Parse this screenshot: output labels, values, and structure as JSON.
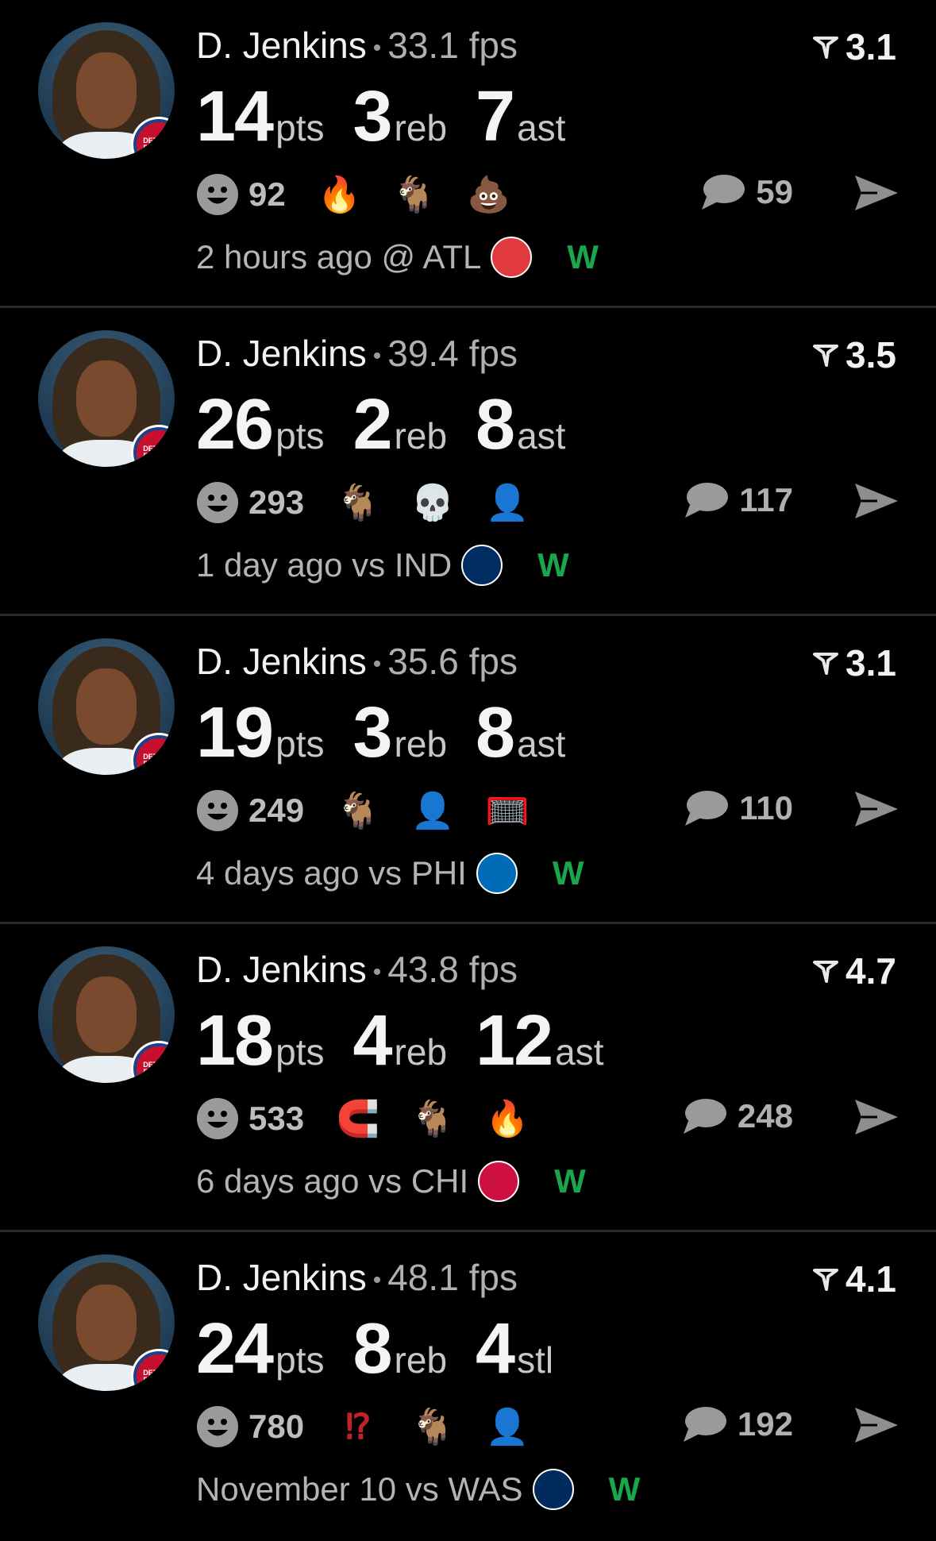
{
  "colors": {
    "win": "#1aa64c",
    "text": "#f2f2f2",
    "muted": "#b0b0b0"
  },
  "posts": [
    {
      "player": "D. Jenkins",
      "fps": "33.1 fps",
      "rating": "3.1",
      "stats": [
        {
          "value": "14",
          "unit": "pts"
        },
        {
          "value": "3",
          "unit": "reb"
        },
        {
          "value": "7",
          "unit": "ast"
        }
      ],
      "reaction_count": "92",
      "emojis": [
        {
          "icon": "fire-icon",
          "glyph": "🔥"
        },
        {
          "icon": "goat-icon",
          "glyph": "🐐"
        },
        {
          "icon": "poop-icon",
          "glyph": "💩"
        }
      ],
      "comment_count": "59",
      "when": "2 hours ago @ ATL",
      "opponent_logo": "hawks-logo",
      "opponent_color": "#e03a3e",
      "result": "W"
    },
    {
      "player": "D. Jenkins",
      "fps": "39.4 fps",
      "rating": "3.5",
      "stats": [
        {
          "value": "26",
          "unit": "pts"
        },
        {
          "value": "2",
          "unit": "reb"
        },
        {
          "value": "8",
          "unit": "ast"
        }
      ],
      "reaction_count": "293",
      "emojis": [
        {
          "icon": "goat-icon",
          "glyph": "🐐"
        },
        {
          "icon": "skull-icon",
          "glyph": "💀"
        },
        {
          "icon": "player-face-icon",
          "glyph": "👤"
        }
      ],
      "comment_count": "117",
      "when": "1 day ago vs IND",
      "opponent_logo": "pacers-logo",
      "opponent_color": "#002d62",
      "result": "W"
    },
    {
      "player": "D. Jenkins",
      "fps": "35.6 fps",
      "rating": "3.1",
      "stats": [
        {
          "value": "19",
          "unit": "pts"
        },
        {
          "value": "3",
          "unit": "reb"
        },
        {
          "value": "8",
          "unit": "ast"
        }
      ],
      "reaction_count": "249",
      "emojis": [
        {
          "icon": "goat-icon",
          "glyph": "🐐"
        },
        {
          "icon": "player-face-icon",
          "glyph": "👤"
        },
        {
          "icon": "basketball-net-icon",
          "glyph": "🥅"
        }
      ],
      "comment_count": "110",
      "when": "4 days ago vs PHI",
      "opponent_logo": "76ers-logo",
      "opponent_color": "#006bb6",
      "result": "W"
    },
    {
      "player": "D. Jenkins",
      "fps": "43.8 fps",
      "rating": "4.7",
      "stats": [
        {
          "value": "18",
          "unit": "pts"
        },
        {
          "value": "4",
          "unit": "reb"
        },
        {
          "value": "12",
          "unit": "ast"
        }
      ],
      "reaction_count": "533",
      "emojis": [
        {
          "icon": "magnet-icon",
          "glyph": "🧲"
        },
        {
          "icon": "goat-icon",
          "glyph": "🐐"
        },
        {
          "icon": "fire-icon",
          "glyph": "🔥"
        }
      ],
      "comment_count": "248",
      "when": "6 days ago vs CHI",
      "opponent_logo": "bulls-logo",
      "opponent_color": "#ce1141",
      "result": "W"
    },
    {
      "player": "D. Jenkins",
      "fps": "48.1 fps",
      "rating": "4.1",
      "stats": [
        {
          "value": "24",
          "unit": "pts"
        },
        {
          "value": "8",
          "unit": "reb"
        },
        {
          "value": "4",
          "unit": "stl"
        }
      ],
      "reaction_count": "780",
      "emojis": [
        {
          "icon": "interrobang-icon",
          "glyph": "⁉"
        },
        {
          "icon": "goat-icon",
          "glyph": "🐐"
        },
        {
          "icon": "player-face-icon",
          "glyph": "👤"
        }
      ],
      "comment_count": "192",
      "when": "November 10 vs WAS",
      "opponent_logo": "wizards-logo",
      "opponent_color": "#002b5c",
      "result": "W"
    }
  ]
}
